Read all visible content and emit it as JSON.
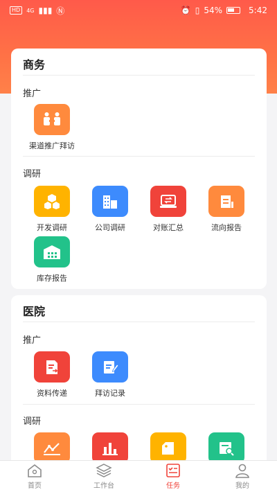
{
  "status_bar": {
    "network_badge": "HD",
    "signal_label": "4G",
    "battery_percent": "54%",
    "time": "5:42"
  },
  "sections": [
    {
      "title": "商务",
      "groups": [
        {
          "label": "推广",
          "items": [
            {
              "label": "渠道推广拜访",
              "icon": "handshake-icon",
              "color": "#ff8a3d"
            }
          ]
        },
        {
          "label": "调研",
          "items": [
            {
              "label": "开发调研",
              "icon": "cubes-icon",
              "color": "#ffb300"
            },
            {
              "label": "公司调研",
              "icon": "building-icon",
              "color": "#3d8bfd"
            },
            {
              "label": "对账汇总",
              "icon": "reconcile-icon",
              "color": "#f0433a"
            },
            {
              "label": "流向报告",
              "icon": "flow-report-icon",
              "color": "#ff8a3d"
            },
            {
              "label": "库存报告",
              "icon": "warehouse-icon",
              "color": "#22c28a"
            }
          ]
        }
      ]
    },
    {
      "title": "医院",
      "groups": [
        {
          "label": "推广",
          "items": [
            {
              "label": "资料传递",
              "icon": "document-send-icon",
              "color": "#f0433a"
            },
            {
              "label": "拜访记录",
              "icon": "visit-record-icon",
              "color": "#3d8bfd"
            }
          ]
        },
        {
          "label": "调研",
          "items": [
            {
              "icon": "trend-chart-icon",
              "color": "#ff8a3d"
            },
            {
              "icon": "bar-chart-icon",
              "color": "#f0433a"
            },
            {
              "icon": "tag-icon",
              "color": "#ffb300"
            },
            {
              "icon": "doc-search-icon",
              "color": "#22c28a"
            }
          ]
        }
      ]
    }
  ],
  "tab_bar": [
    {
      "label": "首页",
      "icon": "home-icon",
      "active": false
    },
    {
      "label": "工作台",
      "icon": "layers-icon",
      "active": false
    },
    {
      "label": "任务",
      "icon": "task-icon",
      "active": true
    },
    {
      "label": "我的",
      "icon": "user-icon",
      "active": false
    }
  ],
  "colors": {
    "accent": "#f0433a",
    "header_start": "#ff5a4a",
    "header_end": "#ff8149"
  }
}
